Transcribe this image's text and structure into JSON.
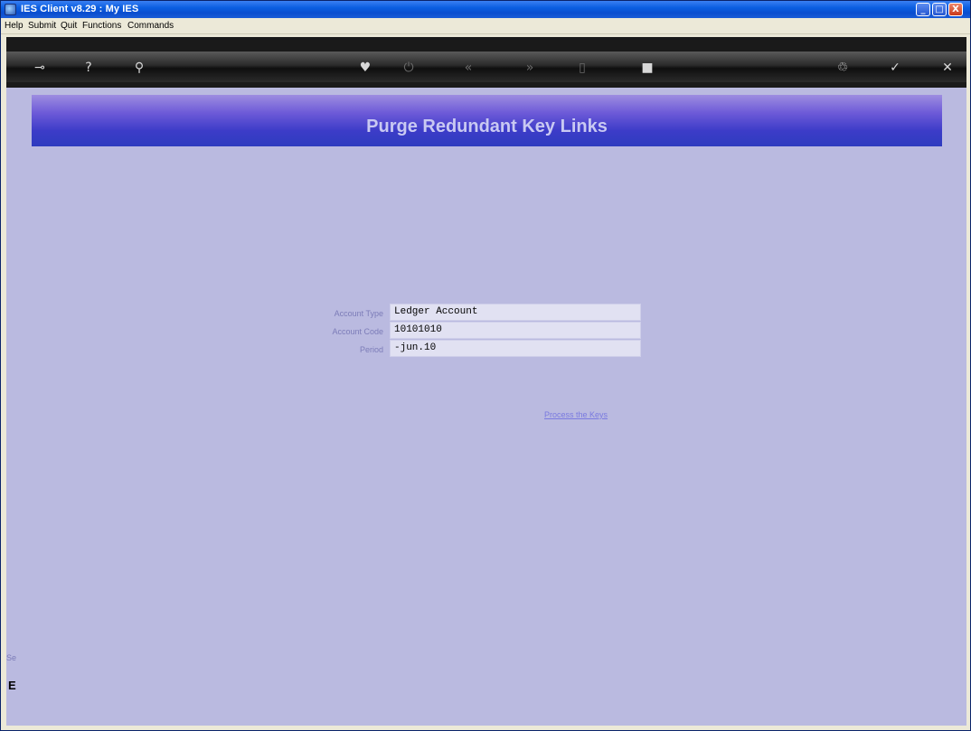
{
  "window": {
    "title": "IES Client v8.29 : My IES",
    "controls": {
      "minimize": "_",
      "maximize": "□",
      "close": "X"
    }
  },
  "menubar": {
    "items": [
      "Help",
      "Submit",
      "Quit",
      "Functions",
      "Commands"
    ]
  },
  "toolbar": {
    "icons": [
      {
        "name": "key-icon",
        "glyph": "⊸",
        "enabled": true
      },
      {
        "name": "help-icon",
        "glyph": "?",
        "enabled": true
      },
      {
        "name": "search-icon",
        "glyph": "⚲",
        "enabled": true
      },
      {
        "name": "heart-icon",
        "glyph": "♥",
        "enabled": true
      },
      {
        "name": "power-icon",
        "glyph": "⏻",
        "enabled": false
      },
      {
        "name": "back-icon",
        "glyph": "«",
        "enabled": false
      },
      {
        "name": "forward-icon",
        "glyph": "»",
        "enabled": false
      },
      {
        "name": "document-icon",
        "glyph": "▯",
        "enabled": false
      },
      {
        "name": "stop-icon",
        "glyph": "■",
        "enabled": true
      },
      {
        "name": "recycle-icon",
        "glyph": "♲",
        "enabled": true
      },
      {
        "name": "check-icon",
        "glyph": "✓",
        "enabled": true
      },
      {
        "name": "close-icon",
        "glyph": "✕",
        "enabled": true
      }
    ]
  },
  "page": {
    "title": "Purge Redundant Key Links",
    "fields": [
      {
        "label": "Account Type",
        "value": "Ledger Account"
      },
      {
        "label": "Account Code",
        "value": "10101010"
      },
      {
        "label": "Period",
        "value": "-jun.10"
      }
    ],
    "process_link": "Process the Keys",
    "left_stub_text": "Se",
    "left_stub_char": "E"
  },
  "colors": {
    "content_bg": "#babae0",
    "header_gradient_top": "#9d8de0",
    "header_gradient_bottom": "#2e3bbf",
    "title_text": "#c9c9f2",
    "field_bg": "#e1e1f2",
    "link": "#7a7ae0"
  }
}
